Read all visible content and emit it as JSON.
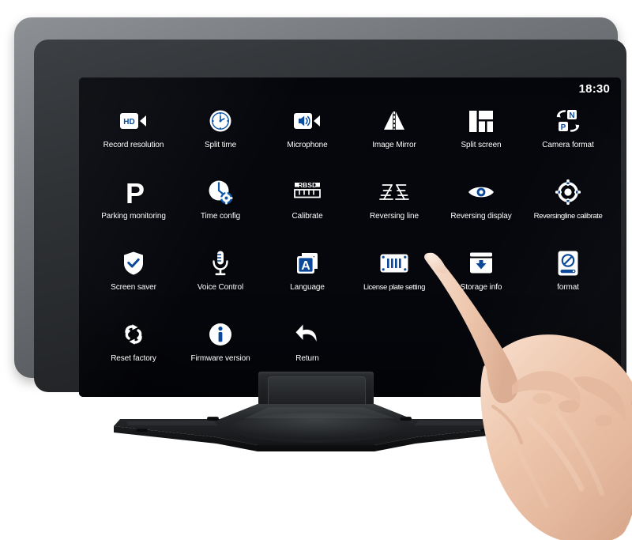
{
  "device": {
    "type": "car-dashcam-touchscreen-monitor",
    "bezel_color": "#2b2d30",
    "frame_color": "#76797d",
    "stand_color": "#16181a"
  },
  "screen": {
    "background_accent": "#14509e",
    "background_deep": "#020d20",
    "status_bar": {
      "clock": "18:30"
    },
    "menu": {
      "columns": 6,
      "items": [
        {
          "label": "Record resolution",
          "icon": "hd-camcorder-icon"
        },
        {
          "label": "Split time",
          "icon": "clock-outline-icon"
        },
        {
          "label": "Microphone",
          "icon": "speaker-camcorder-icon"
        },
        {
          "label": "Image Mirror",
          "icon": "image-mirror-icon"
        },
        {
          "label": "Split screen",
          "icon": "split-screen-grid-icon"
        },
        {
          "label": "Camera format",
          "icon": "camera-format-np-icon"
        },
        {
          "label": "Parking monitoring",
          "icon": "parking-p-icon"
        },
        {
          "label": "Time config",
          "icon": "clock-gear-icon"
        },
        {
          "label": "Calibrate",
          "icon": "rbsd-ruler-icon"
        },
        {
          "label": "Reversing line",
          "icon": "reversing-line-icon"
        },
        {
          "label": "Reversing display",
          "icon": "eye-icon"
        },
        {
          "label": "Reversingline calibrate",
          "icon": "crosshair-target-icon"
        },
        {
          "label": "Screen saver",
          "icon": "shield-check-icon"
        },
        {
          "label": "Voice Control",
          "icon": "microphone-icon"
        },
        {
          "label": "Language",
          "icon": "letter-a-pages-icon"
        },
        {
          "label": "License plate setting",
          "icon": "license-plate-icon"
        },
        {
          "label": "Storage info",
          "icon": "storage-download-icon"
        },
        {
          "label": "format",
          "icon": "disk-no-entry-icon"
        },
        {
          "label": "Reset factory",
          "icon": "reset-loop-icon"
        },
        {
          "label": "Firmware version",
          "icon": "info-circle-icon"
        },
        {
          "label": "Return",
          "icon": "back-arrow-icon"
        }
      ]
    }
  },
  "hand": {
    "description": "right hand with extended index finger touching the screen",
    "skin_color": "#e8c0a8"
  }
}
